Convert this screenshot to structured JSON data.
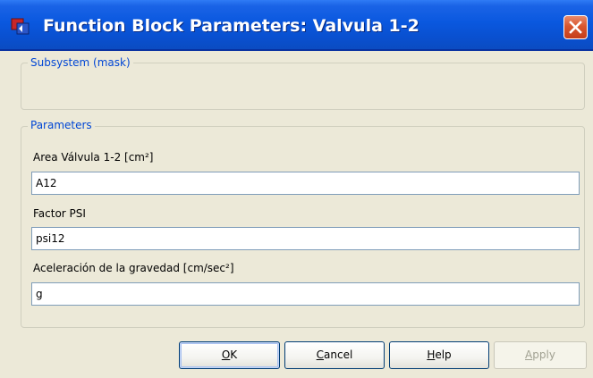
{
  "window": {
    "title": "Function Block Parameters: Valvula 1-2",
    "icon": "simulink-block-icon",
    "close_icon": "close-icon"
  },
  "subsystem": {
    "title": "Subsystem (mask)"
  },
  "parameters": {
    "title": "Parameters",
    "fields": [
      {
        "label": "Area Válvula 1-2 [cm²]",
        "value": "A12"
      },
      {
        "label": "Factor PSI",
        "value": "psi12"
      },
      {
        "label": "Aceleración de la gravedad [cm/sec²]",
        "value": "g"
      }
    ]
  },
  "buttons": {
    "ok": {
      "mnemonic": "O",
      "rest": "K"
    },
    "cancel": {
      "mnemonic": "C",
      "rest": "ancel"
    },
    "help": {
      "mnemonic": "H",
      "rest": "elp"
    },
    "apply": {
      "mnemonic": "A",
      "rest": "pply",
      "enabled": false
    }
  },
  "colors": {
    "titlebar": "#0a58df",
    "group_title": "#0046d5",
    "face": "#ece9d8",
    "close": "#d9572f"
  }
}
